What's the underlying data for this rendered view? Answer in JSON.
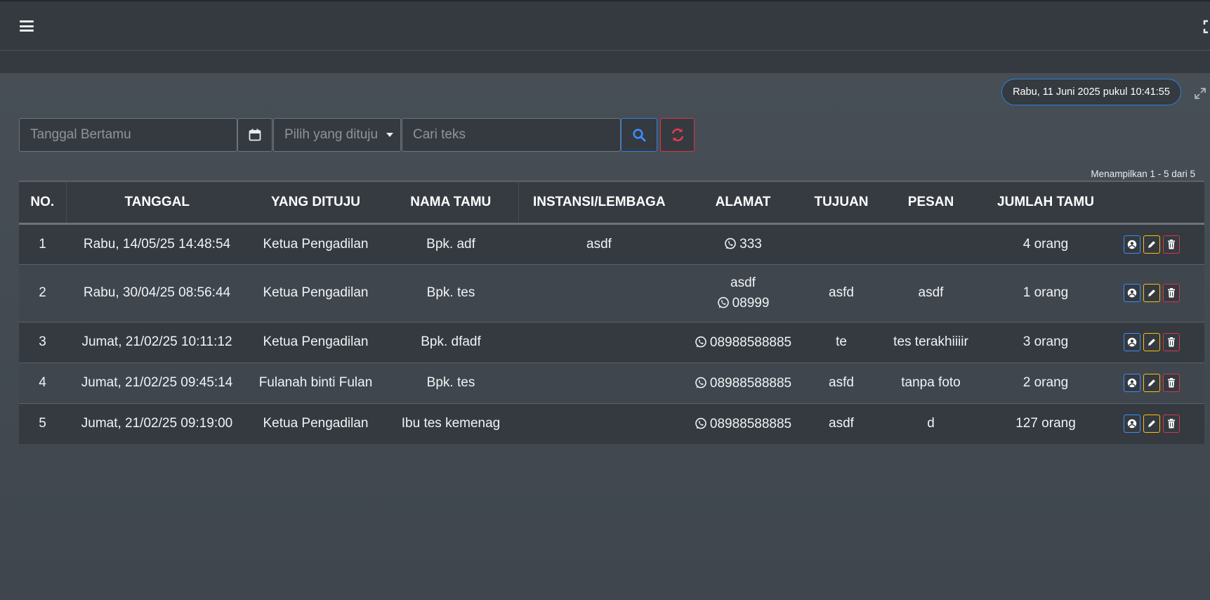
{
  "header": {
    "menu_icon": "hamburger-icon",
    "fullscreen_icon": "expand-icon"
  },
  "datetime": "Rabu, 11 Juni 2025 pukul 10:41:55",
  "filters": {
    "date_placeholder": "Tanggal Bertamu",
    "select_placeholder": "Pilih yang dituju",
    "search_placeholder": "Cari teks"
  },
  "showing": "Menampilkan 1 - 5 dari 5",
  "columns": [
    "NO.",
    "TANGGAL",
    "YANG DITUJU",
    "NAMA TAMU",
    "INSTANSI/LEMBAGA",
    "ALAMAT",
    "TUJUAN",
    "PESAN",
    "JUMLAH TAMU"
  ],
  "rows": [
    {
      "no": "1",
      "tanggal": "Rabu, 14/05/25 14:48:54",
      "dituju": "Ketua Pengadilan",
      "nama": "Bpk. adf",
      "instansi": "asdf",
      "alamat_text": "",
      "phone": "333",
      "tujuan": "",
      "pesan": "",
      "jumlah": "4 orang"
    },
    {
      "no": "2",
      "tanggal": "Rabu, 30/04/25 08:56:44",
      "dituju": "Ketua Pengadilan",
      "nama": "Bpk. tes",
      "instansi": "",
      "alamat_text": "asdf",
      "phone": "08999",
      "tujuan": "asfd",
      "pesan": "asdf",
      "jumlah": "1 orang"
    },
    {
      "no": "3",
      "tanggal": "Jumat, 21/02/25 10:11:12",
      "dituju": "Ketua Pengadilan",
      "nama": "Bpk. dfadf",
      "instansi": "",
      "alamat_text": "",
      "phone": "08988588885",
      "tujuan": "te",
      "pesan": "tes terakhiiiir",
      "jumlah": "3 orang"
    },
    {
      "no": "4",
      "tanggal": "Jumat, 21/02/25 09:45:14",
      "dituju": "Fulanah binti Fulan",
      "nama": "Bpk. tes",
      "instansi": "",
      "alamat_text": "",
      "phone": "08988588885",
      "tujuan": "asfd",
      "pesan": "tanpa foto",
      "jumlah": "2 orang"
    },
    {
      "no": "5",
      "tanggal": "Jumat, 21/02/25 09:19:00",
      "dituju": "Ketua Pengadilan",
      "nama": "Ibu tes kemenag",
      "instansi": "",
      "alamat_text": "",
      "phone": "08988588885",
      "tujuan": "asdf",
      "pesan": "d",
      "jumlah": "127 orang"
    }
  ],
  "colors": {
    "primary": "#2f7fe0",
    "warning": "#ffc107",
    "danger": "#dc3545",
    "surface": "#343a40"
  }
}
